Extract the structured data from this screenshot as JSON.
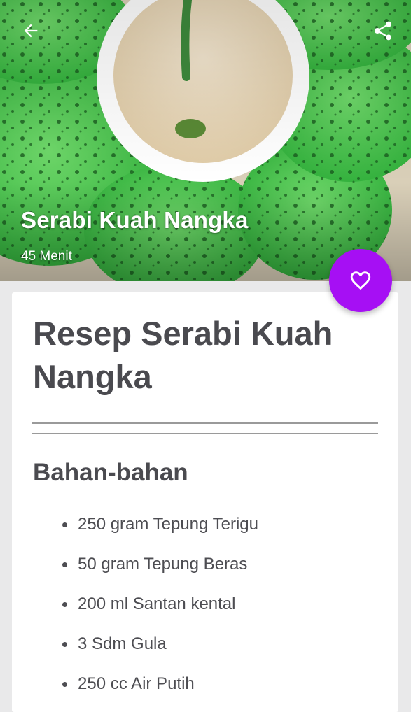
{
  "hero": {
    "title": "Serabi Kuah Nangka",
    "duration": "45 Menit"
  },
  "toolbar": {
    "back_icon": "arrow-left-icon",
    "share_icon": "share-icon"
  },
  "favorite": {
    "icon": "heart-outline-icon",
    "color": "#a60ff4"
  },
  "recipe": {
    "title": "Resep Serabi Kuah Nangka",
    "ingredients_heading": "Bahan-bahan",
    "ingredients": [
      "250 gram Tepung Terigu",
      "50 gram Tepung Beras",
      "200 ml Santan kental",
      "3 Sdm Gula",
      "250 cc Air Putih"
    ]
  }
}
